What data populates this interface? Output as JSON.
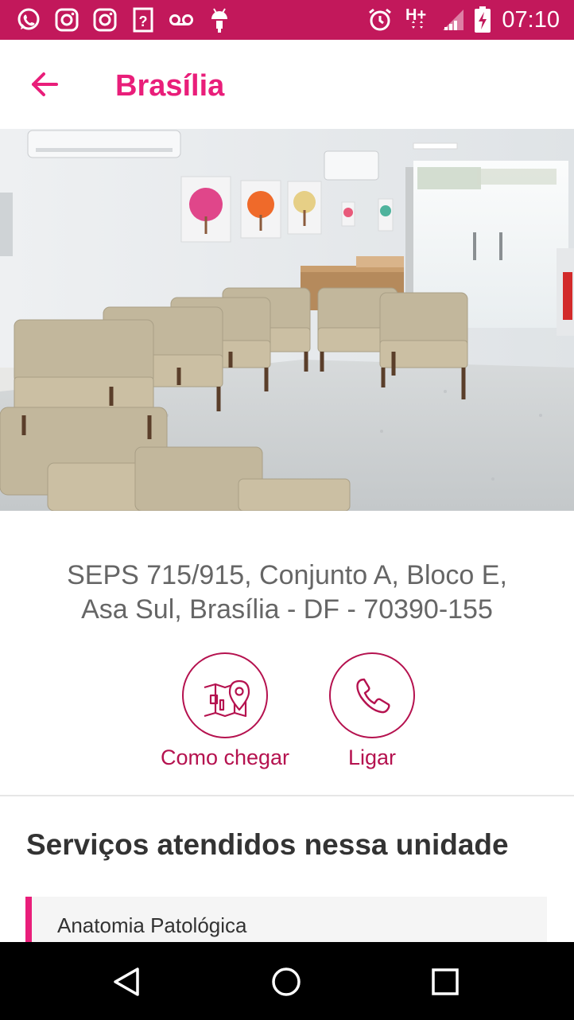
{
  "status_bar": {
    "time": "07:10",
    "network": "H+",
    "notification_icons": [
      "whatsapp-icon",
      "instagram-icon",
      "instagram-icon",
      "unknown-notification-icon",
      "voicemail-icon",
      "android-debug-icon"
    ],
    "system_icons": [
      "alarm-icon",
      "network-h-plus-icon",
      "signal-icon",
      "battery-charging-icon"
    ],
    "background": "#c2185b"
  },
  "app_bar": {
    "title": "Brasília",
    "back_icon": "arrow-left-icon",
    "accent": "#e91e7a"
  },
  "address": {
    "line1": "SEPS 715/915, Conjunto A, Bloco E,",
    "line2": "Asa Sul, Brasília - DF - 70390-155"
  },
  "actions": {
    "directions_label": "Como chegar",
    "directions_icon": "map-pin-icon",
    "call_label": "Ligar",
    "call_icon": "phone-icon",
    "color": "#b5124f"
  },
  "services": {
    "title": "Serviços atendidos nessa unidade",
    "items": [
      {
        "label": "Anatomia Patológica"
      }
    ]
  },
  "nav_bar": {
    "icons": [
      "back-triangle-icon",
      "home-circle-icon",
      "recents-square-icon"
    ]
  }
}
